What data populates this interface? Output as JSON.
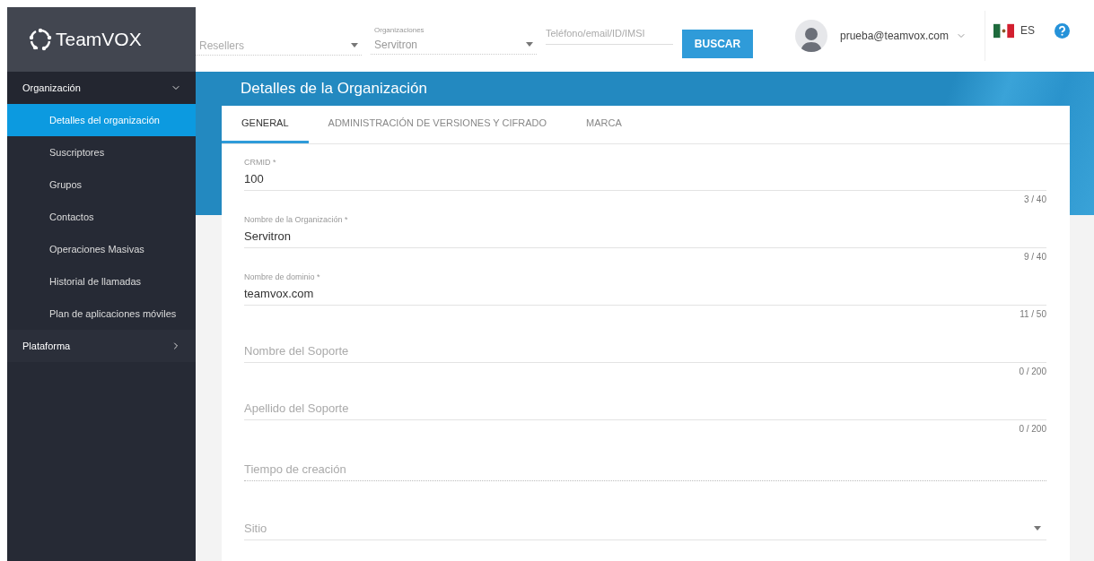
{
  "logo": {
    "text": "TeamVOX"
  },
  "topbar": {
    "resellers": {
      "value": "Resellers"
    },
    "organizations": {
      "label": "Organizaciones",
      "value": "Servitron"
    },
    "search": {
      "placeholder": "Teléfono/email/ID/IMSI"
    },
    "search_button": "BUSCAR",
    "user": "prueba@teamvox.com",
    "language": "ES"
  },
  "sidebar": {
    "sections": [
      {
        "label": "Organización",
        "expanded": true,
        "children": [
          {
            "label": "Detalles del organización",
            "selected": true
          },
          {
            "label": "Suscriptores",
            "selected": false
          },
          {
            "label": "Grupos",
            "selected": false
          },
          {
            "label": "Contactos",
            "selected": false
          },
          {
            "label": "Operaciones Masivas",
            "selected": false
          },
          {
            "label": "Historial de llamadas",
            "selected": false
          },
          {
            "label": "Plan de aplicaciones móviles",
            "selected": false
          }
        ]
      },
      {
        "label": "Plataforma",
        "expanded": false
      }
    ]
  },
  "page_title": "Detalles de la Organización",
  "tabs": [
    {
      "label": "GENERAL",
      "selected": true
    },
    {
      "label": "ADMINISTRACIÓN DE VERSIONES Y CIFRADO",
      "selected": false
    },
    {
      "label": "MARCA",
      "selected": false
    }
  ],
  "fields": [
    {
      "kind": "text",
      "label": "CRMID *",
      "value": "100",
      "counter": "3 / 40"
    },
    {
      "kind": "text",
      "label": "Nombre de la Organización *",
      "value": "Servitron",
      "counter": "9 / 40"
    },
    {
      "kind": "text",
      "label": "Nombre de dominio *",
      "value": "teamvox.com",
      "counter": "11 / 50"
    },
    {
      "kind": "text",
      "placeholder": "Nombre del Soporte",
      "counter": "0 / 200"
    },
    {
      "kind": "text",
      "placeholder": "Apellido del Soporte",
      "counter": "0 / 200"
    },
    {
      "kind": "readonly",
      "placeholder": "Tiempo de creación"
    },
    {
      "kind": "select",
      "placeholder": "Sitio"
    }
  ]
}
